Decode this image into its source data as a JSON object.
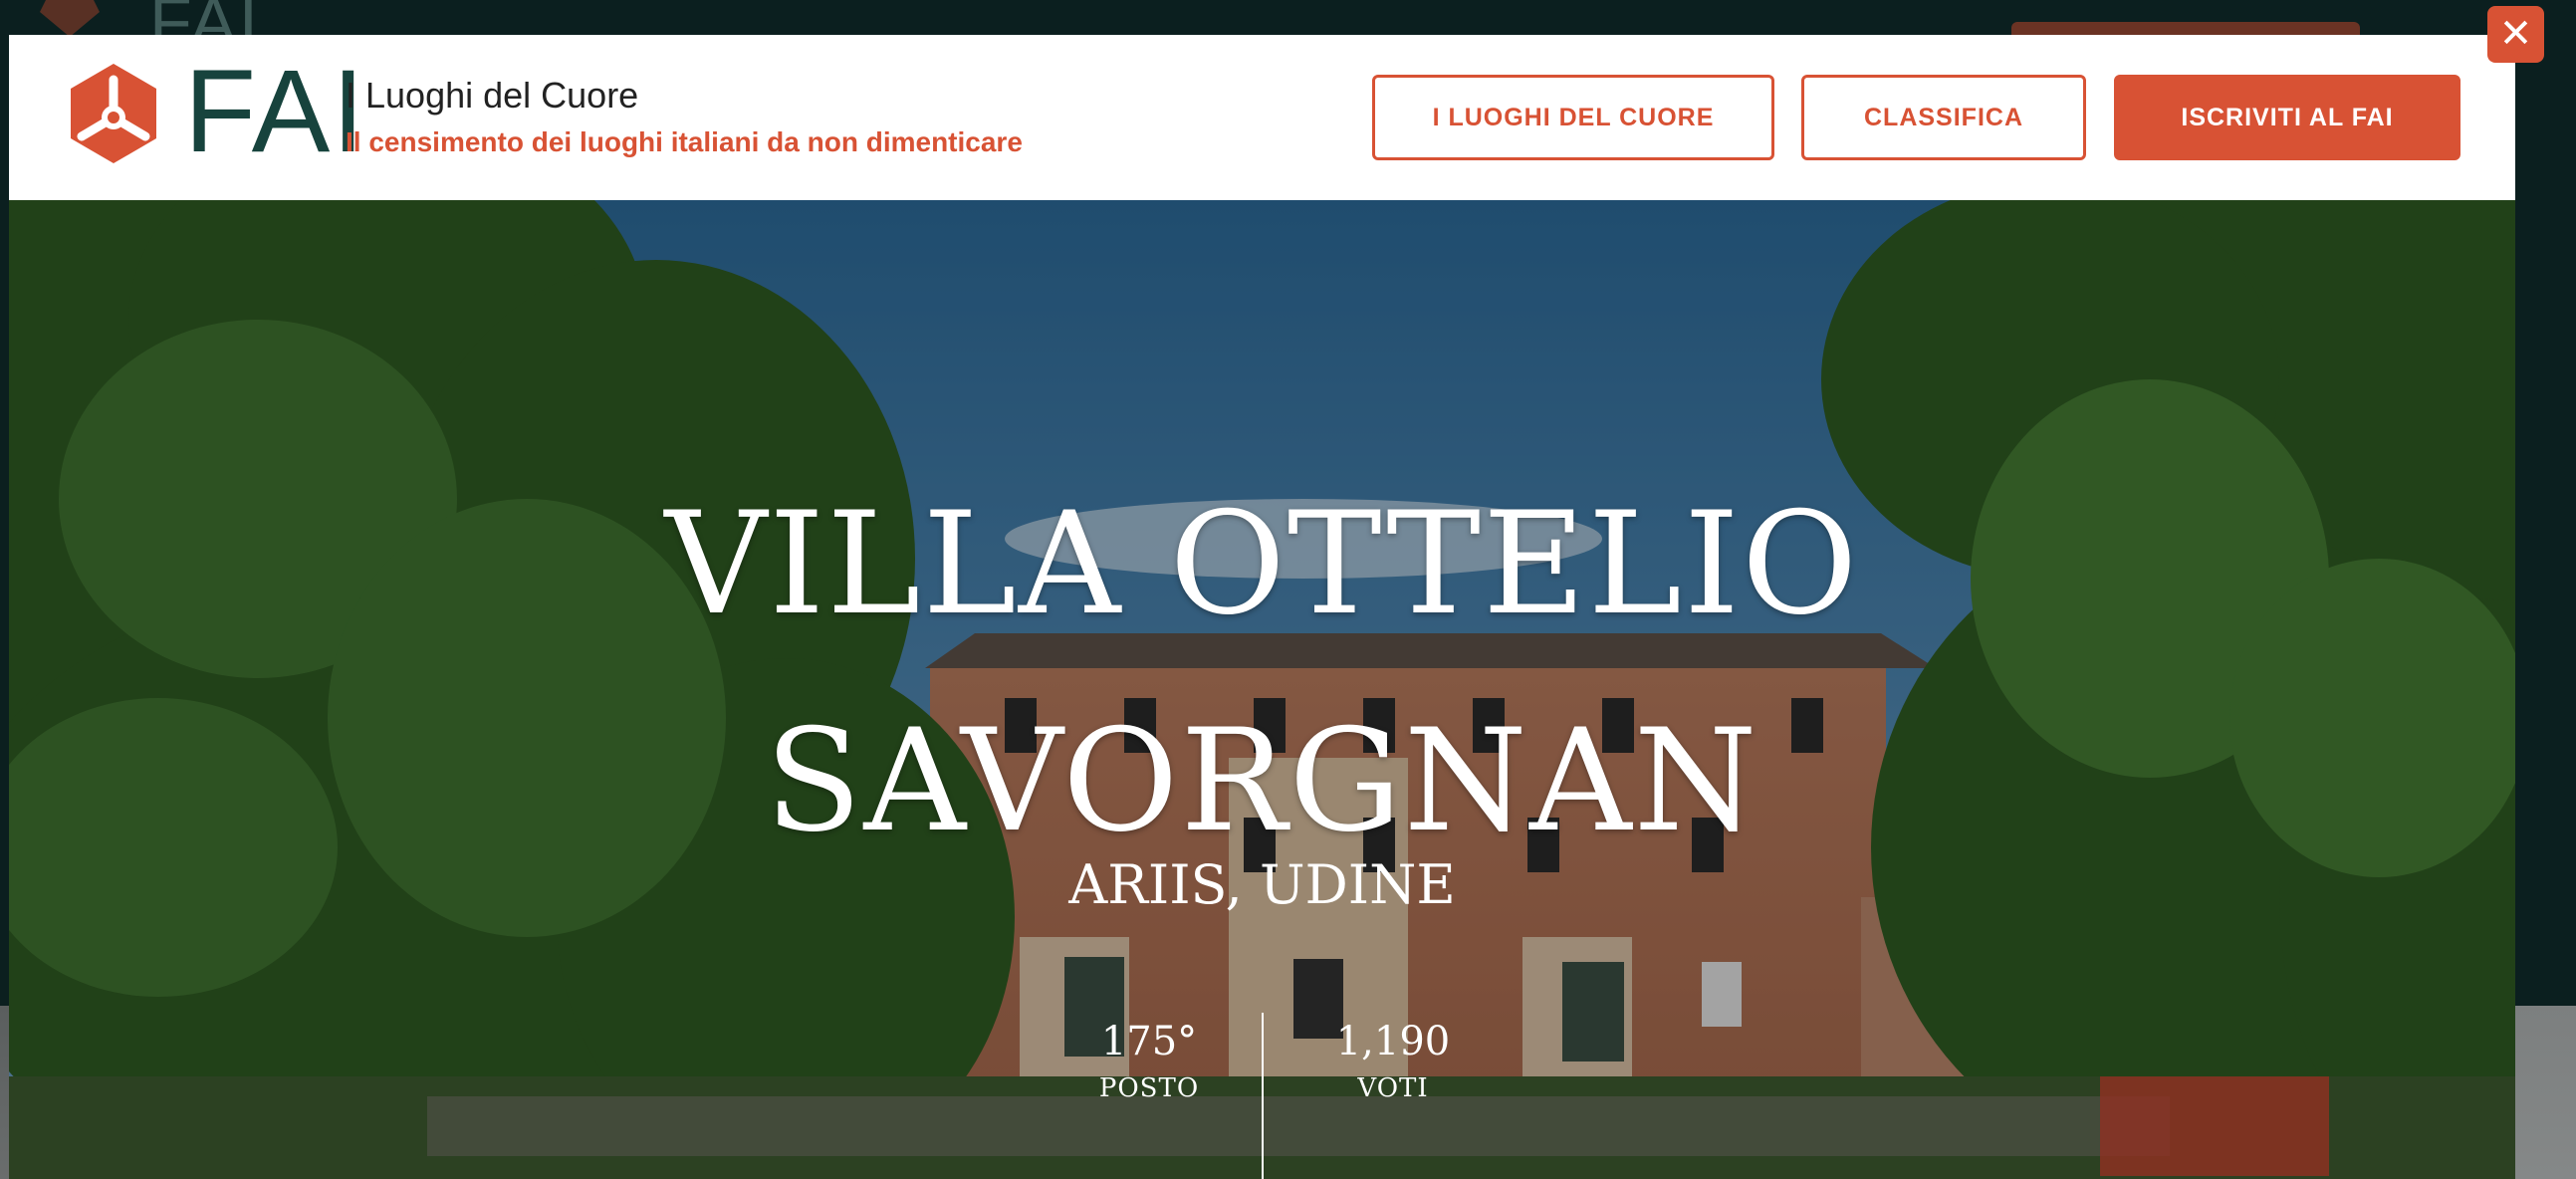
{
  "background_page": {
    "logo_text": "FAI"
  },
  "modal": {
    "close_symbol": "✕"
  },
  "header": {
    "logo_text": "FAI",
    "site_title": "I Luoghi del Cuore",
    "site_subtitle": "Il censimento dei luoghi italiani da non dimenticare",
    "buttons": {
      "luoghi": "I LUOGHI DEL CUORE",
      "classifica": "CLASSIFICA",
      "iscriviti": "ISCRIVITI AL FAI"
    }
  },
  "hero": {
    "title_line1": "VILLA OTTELIO",
    "title_line2": "SAVORGNAN",
    "location": "ARIIS, UDINE",
    "rank": {
      "value": "175°",
      "label": "POSTO"
    },
    "votes": {
      "value": "1,190",
      "label": "VOTI"
    }
  },
  "colors": {
    "accent": "#d85234",
    "logo_green": "#17433d",
    "backdrop": "#0b1f1f"
  },
  "icons": {
    "logo": "fai-logo-icon",
    "close": "close-icon"
  }
}
